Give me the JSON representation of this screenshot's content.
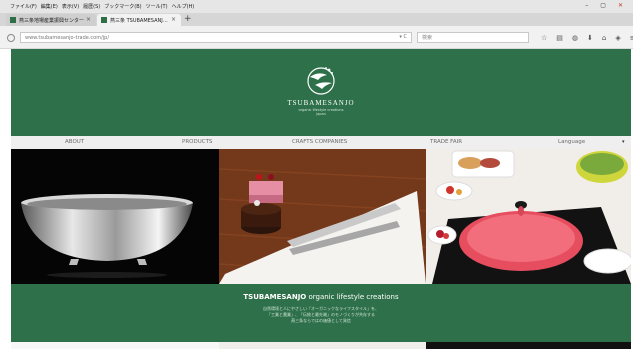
{
  "browser": {
    "menu": [
      "ファイル(F)",
      "編集(E)",
      "表示(V)",
      "履歴(S)",
      "ブックマーク(B)",
      "ツール(T)",
      "ヘルプ(H)"
    ],
    "window_controls": {
      "minimize": "–",
      "maximize": "▢",
      "close": "✕"
    },
    "tabs": [
      {
        "label": "燕三条地場産業振興センター"
      },
      {
        "label": "燕三条 TSUBAMESANJ…"
      }
    ],
    "tab_close_glyph": "×",
    "new_tab_glyph": "+",
    "url": "www.tsubamesanjo-trade.com/jp/",
    "url_reload_glyph": "▾ C",
    "search_placeholder": "検索",
    "toolbar_icons": [
      "star-icon",
      "reading-list-icon",
      "pocket-icon",
      "download-icon",
      "home-icon",
      "shield-icon",
      "menu-icon"
    ]
  },
  "site": {
    "brand": {
      "name": "TSUBAMESANJO",
      "tagline": "organic lifestyle creations",
      "place": "japan"
    },
    "nav": {
      "about": "ABOUT",
      "products": "PRODUCTS",
      "crafts": "CRAFTS COMPANIES",
      "trade": "TRADE FAIR",
      "language": "Language",
      "caret": "▾"
    },
    "photos": [
      {
        "subject": "stainless steel bowl"
      },
      {
        "subject": "desserts with serving tongs"
      },
      {
        "subject": "red pot on induction cooker"
      }
    ],
    "caption": {
      "title_brand": "TSUBAMESANJO",
      "title_rest": " organic lifestyle creations",
      "lines": [
        "自然環境と人にやさしい「オーガニックなライフスタイル」を、",
        "「工業と農業」、「伝統と最先端」のモノづくりが共存する",
        "燕三条ならではの価値として発信"
      ]
    }
  },
  "colors": {
    "brand_green": "#2e7049",
    "nav_bg": "#efefef"
  }
}
